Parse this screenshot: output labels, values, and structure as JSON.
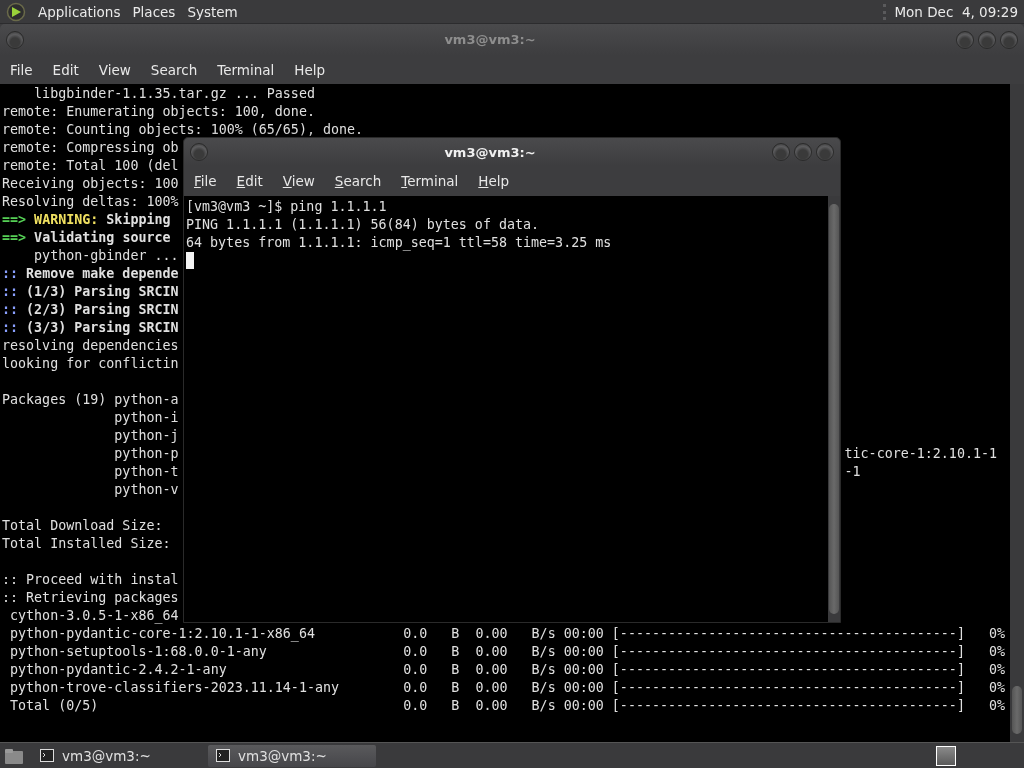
{
  "top_panel": {
    "menus": [
      {
        "label": "Applications"
      },
      {
        "label": "Places"
      },
      {
        "label": "System"
      }
    ],
    "clock": "Mon Dec  4, 09:29"
  },
  "back_window": {
    "title": "vm3@vm3:~",
    "active": false,
    "menu": [
      "File",
      "Edit",
      "View",
      "Search",
      "Terminal",
      "Help"
    ],
    "lines": [
      {
        "kind": "text",
        "segments": [
          {
            "kind": "plain",
            "text": "    libgbinder-1.1.35.tar.gz ... Passed"
          }
        ]
      },
      {
        "kind": "text",
        "segments": [
          {
            "kind": "plain",
            "text": "remote: Enumerating objects: 100, done."
          }
        ]
      },
      {
        "kind": "text",
        "segments": [
          {
            "kind": "plain",
            "text": "remote: Counting objects: 100% (65/65), done."
          }
        ]
      },
      {
        "kind": "text",
        "segments": [
          {
            "kind": "plain",
            "text": "remote: Compressing ob"
          }
        ]
      },
      {
        "kind": "text",
        "segments": [
          {
            "kind": "plain",
            "text": "remote: Total 100 (del"
          }
        ]
      },
      {
        "kind": "text",
        "segments": [
          {
            "kind": "plain",
            "text": "Receiving objects: 100"
          }
        ]
      },
      {
        "kind": "text",
        "segments": [
          {
            "kind": "plain",
            "text": "Resolving deltas: 100%"
          }
        ]
      },
      {
        "kind": "text",
        "segments": [
          {
            "kind": "arrow",
            "text": "==> "
          },
          {
            "kind": "warning",
            "text": "WARNING: "
          },
          {
            "kind": "bold",
            "text": "Skipping"
          }
        ]
      },
      {
        "kind": "text",
        "segments": [
          {
            "kind": "arrow",
            "text": "==> "
          },
          {
            "kind": "bold",
            "text": "Validating source"
          }
        ]
      },
      {
        "kind": "text",
        "segments": [
          {
            "kind": "plain",
            "text": "    python-gbinder ..."
          }
        ]
      },
      {
        "kind": "text",
        "segments": [
          {
            "kind": "marker",
            "text": ":: "
          },
          {
            "kind": "bold",
            "text": "Remove make depende"
          }
        ]
      },
      {
        "kind": "text",
        "segments": [
          {
            "kind": "marker",
            "text": ":: "
          },
          {
            "kind": "bold",
            "text": "(1/3) Parsing SRCIN"
          }
        ]
      },
      {
        "kind": "text",
        "segments": [
          {
            "kind": "marker",
            "text": ":: "
          },
          {
            "kind": "bold",
            "text": "(2/3) Parsing SRCIN"
          }
        ]
      },
      {
        "kind": "text",
        "segments": [
          {
            "kind": "marker",
            "text": ":: "
          },
          {
            "kind": "bold",
            "text": "(3/3) Parsing SRCIN"
          }
        ]
      },
      {
        "kind": "text",
        "segments": [
          {
            "kind": "plain",
            "text": "resolving dependencies"
          }
        ]
      },
      {
        "kind": "text",
        "segments": [
          {
            "kind": "plain",
            "text": "looking for conflictin"
          }
        ]
      },
      {
        "kind": "blank"
      },
      {
        "kind": "text",
        "segments": [
          {
            "kind": "plain",
            "text": "Packages (19) python-a"
          }
        ]
      },
      {
        "kind": "text",
        "segments": [
          {
            "kind": "plain",
            "text": "              python-i"
          }
        ]
      },
      {
        "kind": "text",
        "segments": [
          {
            "kind": "plain",
            "text": "              python-j"
          }
        ]
      },
      {
        "kind": "text",
        "segments": [
          {
            "kind": "plain",
            "text": "              python-p"
          }
        ],
        "right_text": "tic-core-1:2.10.1-1"
      },
      {
        "kind": "text",
        "segments": [
          {
            "kind": "plain",
            "text": "              python-t"
          }
        ],
        "right_text": "-1"
      },
      {
        "kind": "text",
        "segments": [
          {
            "kind": "plain",
            "text": "              python-v"
          }
        ]
      },
      {
        "kind": "blank"
      },
      {
        "kind": "text",
        "segments": [
          {
            "kind": "plain",
            "text": "Total Download Size:"
          }
        ]
      },
      {
        "kind": "text",
        "segments": [
          {
            "kind": "plain",
            "text": "Total Installed Size:"
          }
        ]
      },
      {
        "kind": "blank"
      },
      {
        "kind": "text",
        "segments": [
          {
            "kind": "plain",
            "text": ":: Proceed with instal"
          }
        ]
      },
      {
        "kind": "text",
        "segments": [
          {
            "kind": "plain",
            "text": ":: Retrieving packages"
          }
        ]
      },
      {
        "kind": "text",
        "segments": [
          {
            "kind": "plain",
            "text": " cython-3.0.5-1-x86_64"
          }
        ]
      }
    ],
    "downloads": [
      {
        "name": "python-pydantic-core-1:2.10.1-1-x86_64",
        "size": "0.0",
        "size_unit": "B",
        "rate": "0.00",
        "rate_unit": "B/s",
        "eta": "00:00",
        "bar": "[------------------------------------------]",
        "percent": "0%"
      },
      {
        "name": "python-setuptools-1:68.0.0-1-any",
        "size": "0.0",
        "size_unit": "B",
        "rate": "0.00",
        "rate_unit": "B/s",
        "eta": "00:00",
        "bar": "[------------------------------------------]",
        "percent": "0%"
      },
      {
        "name": "python-pydantic-2.4.2-1-any",
        "size": "0.0",
        "size_unit": "B",
        "rate": "0.00",
        "rate_unit": "B/s",
        "eta": "00:00",
        "bar": "[------------------------------------------]",
        "percent": "0%"
      },
      {
        "name": "python-trove-classifiers-2023.11.14-1-any",
        "size": "0.0",
        "size_unit": "B",
        "rate": "0.00",
        "rate_unit": "B/s",
        "eta": "00:00",
        "bar": "[------------------------------------------]",
        "percent": "0%"
      },
      {
        "name": "Total (0/5)",
        "size": "0.0",
        "size_unit": "B",
        "rate": "0.00",
        "rate_unit": "B/s",
        "eta": "00:00",
        "bar": "[------------------------------------------]",
        "percent": "0%"
      }
    ]
  },
  "front_window": {
    "title": "vm3@vm3:~",
    "active": true,
    "menu": [
      "File",
      "Edit",
      "View",
      "Search",
      "Terminal",
      "Help"
    ],
    "lines": [
      "[vm3@vm3 ~]$ ping 1.1.1.1",
      "PING 1.1.1.1 (1.1.1.1) 56(84) bytes of data.",
      "64 bytes from 1.1.1.1: icmp_seq=1 ttl=58 time=3.25 ms"
    ],
    "cursor": true
  },
  "taskbar": {
    "tasks": [
      {
        "label": "vm3@vm3:~",
        "selected": false
      },
      {
        "label": "vm3@vm3:~",
        "selected": true
      }
    ]
  }
}
